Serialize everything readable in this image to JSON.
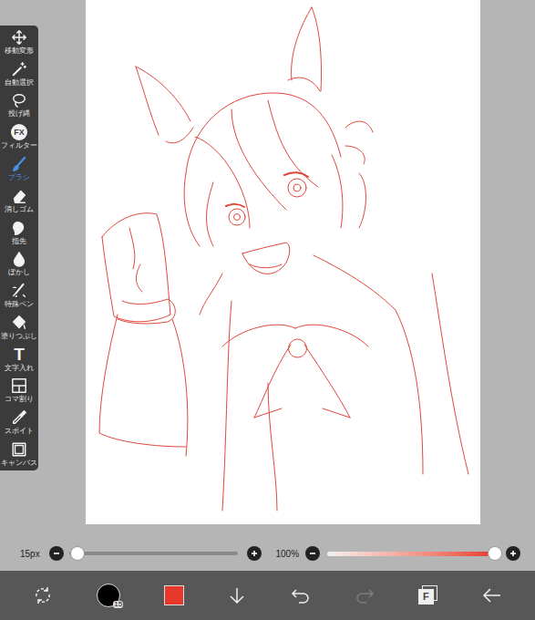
{
  "tools": [
    {
      "label": "移動変形",
      "selected": false
    },
    {
      "label": "自動選択",
      "selected": false
    },
    {
      "label": "投げ縄",
      "selected": false
    },
    {
      "label": "フィルター",
      "selected": false,
      "glyph": "FX"
    },
    {
      "label": "ブラシ",
      "selected": true
    },
    {
      "label": "消しゴム",
      "selected": false
    },
    {
      "label": "指先",
      "selected": false
    },
    {
      "label": "ぼかし",
      "selected": false
    },
    {
      "label": "特殊ペン",
      "selected": false
    },
    {
      "label": "塗りつぶし",
      "selected": false
    },
    {
      "label": "文字入れ",
      "selected": false,
      "glyph": "T"
    },
    {
      "label": "コマ割り",
      "selected": false
    },
    {
      "label": "スポイト",
      "selected": false
    },
    {
      "label": "キャンバス",
      "selected": false
    }
  ],
  "brush_size": {
    "reading": "15px",
    "level": 0.05
  },
  "opacity": {
    "reading": "100%",
    "level": 1.0
  },
  "bottom_bar": {
    "brush_badge": "15",
    "current_color": "#e8372b",
    "redo_disabled": true,
    "layers_glyph": "F"
  }
}
